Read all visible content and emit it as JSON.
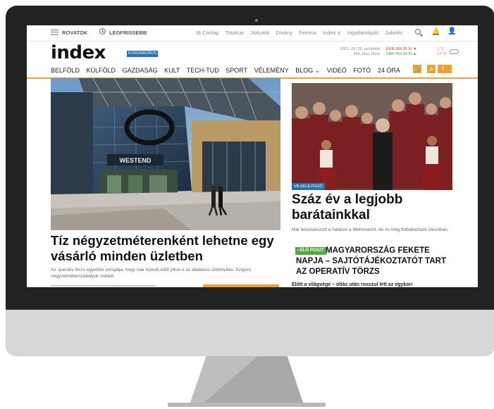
{
  "topbar": {
    "rovatok": "ROVATOK",
    "legfrissebb": "LEGFRISSEBB",
    "links": [
      "IB Címlap",
      "Totalcar",
      "JóAutók",
      "Dívány",
      "Femina",
      "Index ∨",
      "Ingatlantájoló",
      "Jobinfo"
    ]
  },
  "header": {
    "logo": "index",
    "corona_badge": "KORONAVÍRUS",
    "date_line": "2021. 03. 25. csütörtök",
    "nameday_line": "Irén, Írisz, Ilona",
    "eur_rate": "EUR 364,35 Ft ▼",
    "gbp_rate": "GBP 422,93 Ft ▲",
    "temp_low": "3 °C",
    "temp_high": "12 °C"
  },
  "nav": {
    "items": [
      "BELFÖLD",
      "KÜLFÖLD",
      "GAZDASÁG",
      "KULT",
      "TECH-TUD",
      "SPORT",
      "VÉLEMÉNY",
      "BLOG ⌄",
      "VIDEÓ",
      "FOTÓ",
      "24 ÓRA"
    ],
    "icon1": "⚓",
    "icon2": "ʌ",
    "icon3": "f ·"
  },
  "main_article": {
    "mall_sign": "WESTEND",
    "headline": "Tíz négyzetméterenként lehetne egy vásárló minden üzletben",
    "lead": "Az operatív törzs egyelőre vizsgálja, hogy már húsvét előtt jöhet-e az általános üzletnyitás. Szigorú négyzetméterszabályok mellett."
  },
  "side_article": {
    "tag": "VB-SELEJTEZŐ",
    "headline": "Száz év a legjobb barátainkkal",
    "lead": "Már felsorakozott a határon a Wehrmacht, de mi még futballoztunk Varsóban."
  },
  "live_article": {
    "tag": "• ÉLŐ POSZT",
    "headline": "MAGYARORSZÁG FEKETE NAPJA – SAJTÓTÁJÉKOZTATÓT TART AZ OPERATÍV TÖRZS",
    "snippet": "Előtt a világvége – oltás után rosszul lett az egykori"
  },
  "colors": {
    "accent_orange": "#f0a030",
    "badge_blue": "#2a6fb0",
    "live_green": "#4fae3a",
    "bezel": "#222222"
  }
}
